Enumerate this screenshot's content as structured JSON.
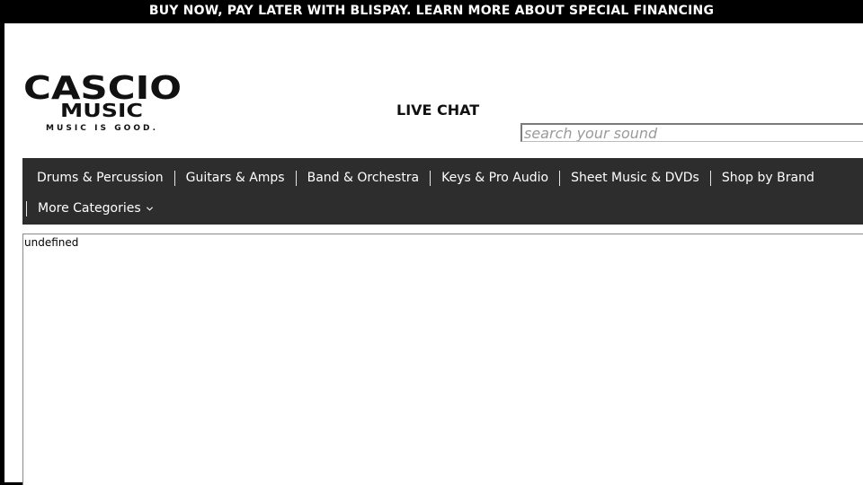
{
  "promo": {
    "text": "BUY NOW, PAY LATER WITH BLISPAY. LEARN MORE ABOUT SPECIAL FINANCING"
  },
  "header": {
    "logo": {
      "line1": "CASCIO",
      "line2": "MUSIC",
      "tagline": "MUSIC IS GOOD."
    },
    "live_chat_label": "LIVE CHAT",
    "search": {
      "value": "",
      "placeholder": "search your sound"
    }
  },
  "nav": {
    "items": [
      {
        "label": "Drums & Percussion"
      },
      {
        "label": "Guitars & Amps"
      },
      {
        "label": "Band & Orchestra"
      },
      {
        "label": "Keys & Pro Audio"
      },
      {
        "label": "Sheet Music & DVDs"
      },
      {
        "label": "Shop by Brand"
      },
      {
        "label": "More Categories",
        "icon": "chevron-down-icon"
      }
    ]
  },
  "content": {
    "frame_text": "undefined"
  },
  "colors": {
    "promo_bg": "#000000",
    "nav_bg": "#2d2d2d",
    "text_primary": "#111111"
  }
}
